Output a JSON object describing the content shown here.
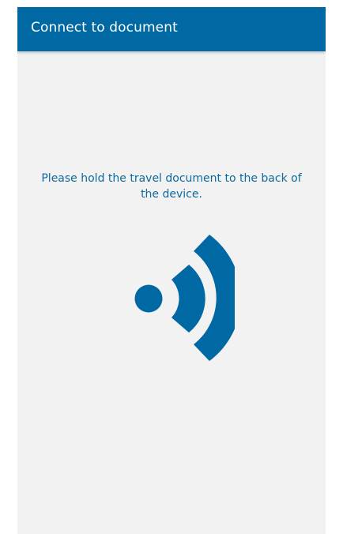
{
  "app_bar": {
    "title": "Connect to document",
    "background_color": "#0068a2",
    "title_color": "#ffffff"
  },
  "main": {
    "background_color": "#f2f2f2",
    "instruction": "Please hold the travel document to the back of the device.",
    "instruction_color": "#0e6a9e",
    "icon": {
      "name": "nfc-signal-icon",
      "color": "#0068a2"
    }
  }
}
